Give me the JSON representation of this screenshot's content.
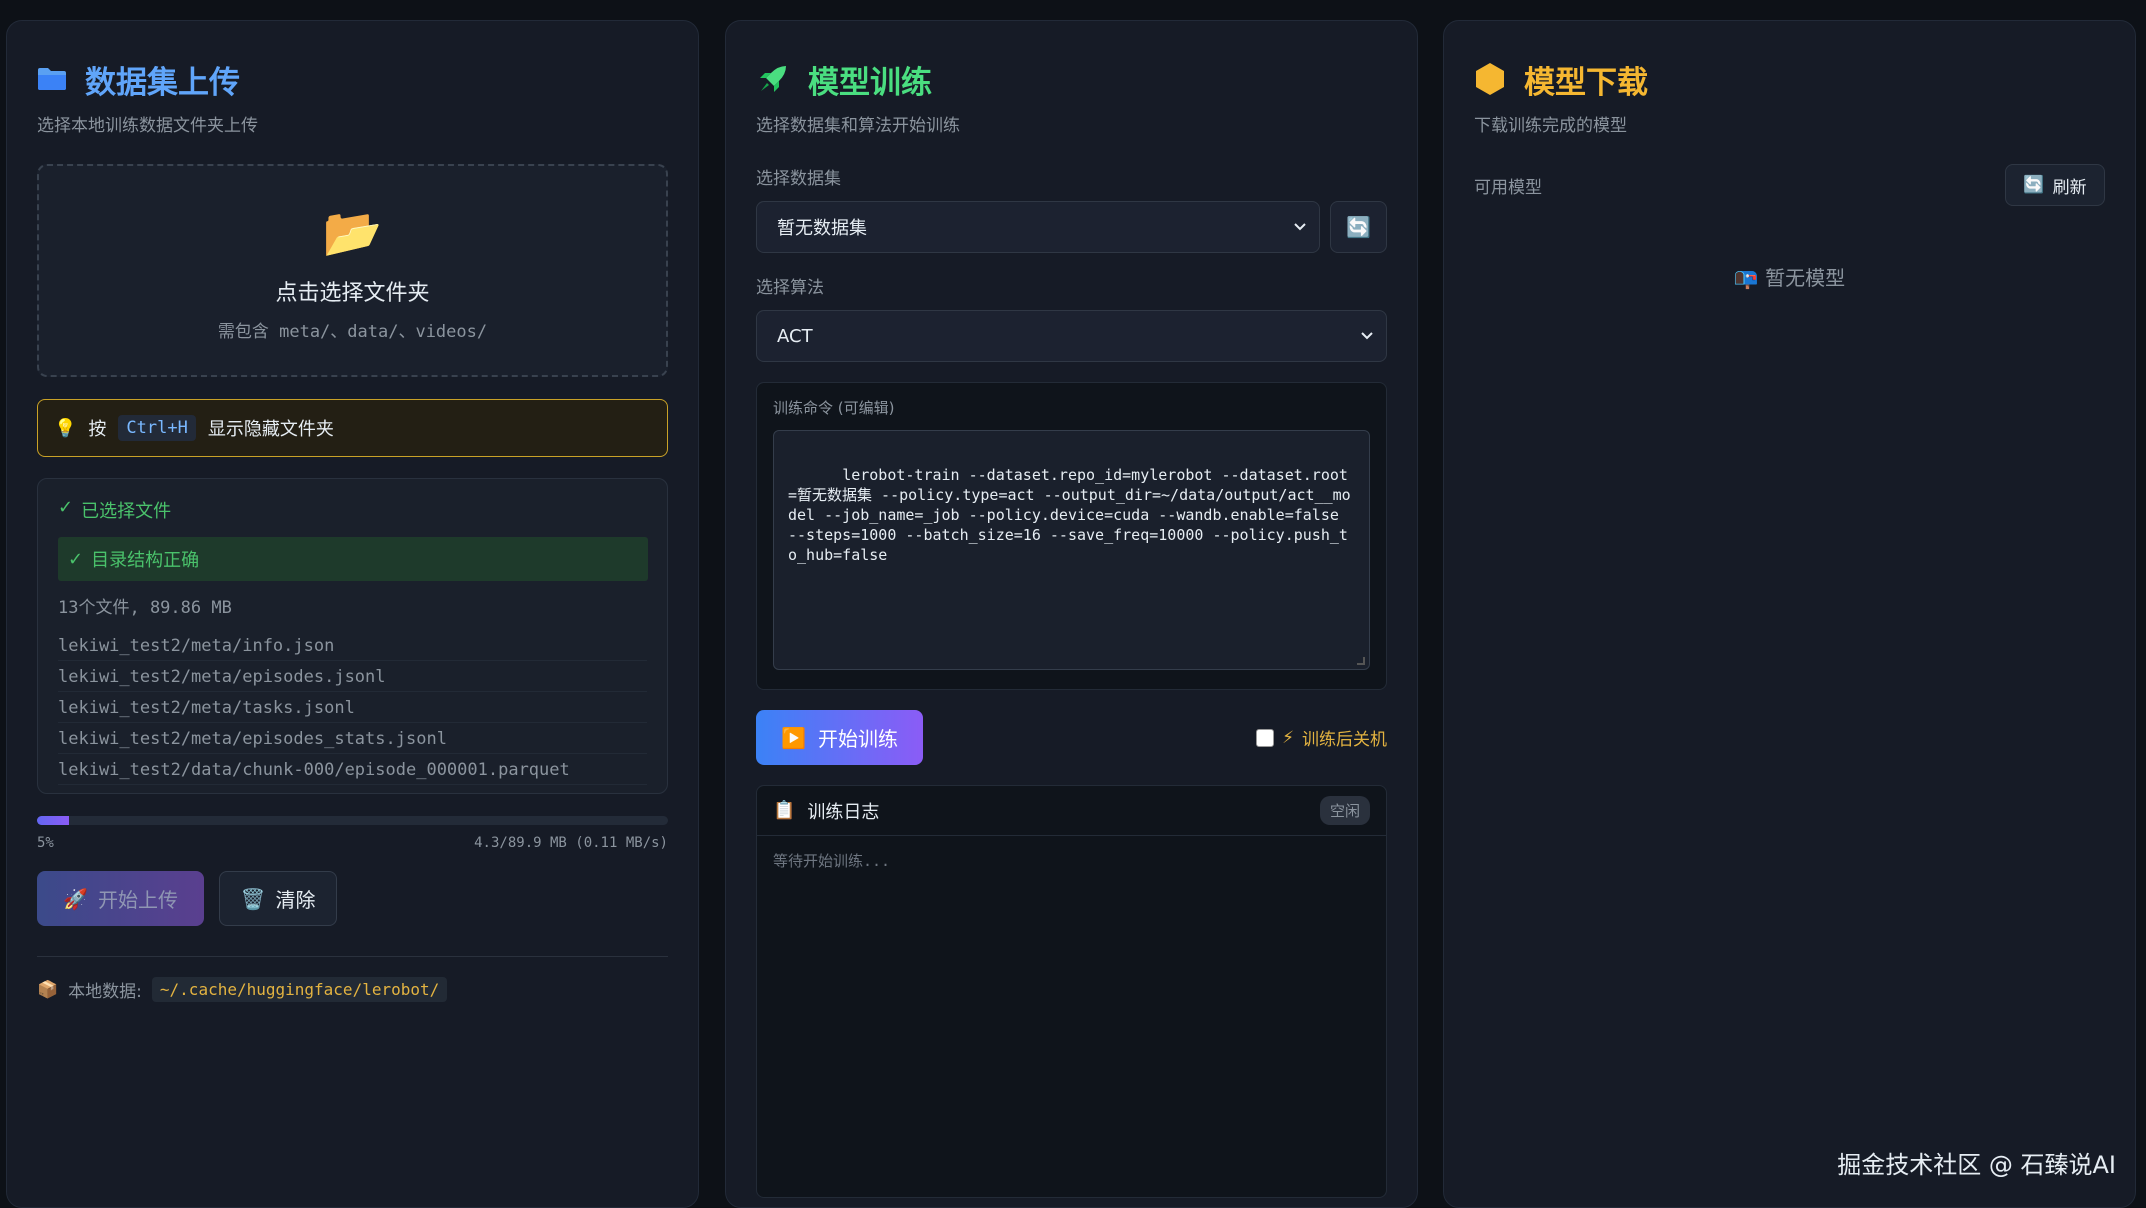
{
  "upload": {
    "title": "数据集上传",
    "title_color": "#60a5fa",
    "subtitle": "选择本地训练数据文件夹上传",
    "icon": "folder-icon",
    "dropzone": {
      "icon": "📂",
      "title": "点击选择文件夹",
      "hint": "需包含 meta/、data/、videos/"
    },
    "tip": {
      "icon": "💡",
      "prefix": "按",
      "key": "Ctrl+H",
      "suffix": "显示隐藏文件夹"
    },
    "selected": {
      "check": "✓",
      "header": "已选择文件",
      "structure_ok": "目录结构正确",
      "stats": "13个文件, 89.86 MB",
      "files": [
        "lekiwi_test2/meta/info.json",
        "lekiwi_test2/meta/episodes.jsonl",
        "lekiwi_test2/meta/tasks.jsonl",
        "lekiwi_test2/meta/episodes_stats.jsonl",
        "lekiwi_test2/data/chunk-000/episode_000001.parquet"
      ]
    },
    "progress": {
      "percent": 5,
      "percent_label": "5%",
      "detail": "4.3/89.9 MB (0.11 MB/s)"
    },
    "buttons": {
      "upload_icon": "🚀",
      "upload": "开始上传",
      "clear_icon": "🗑️",
      "clear": "清除"
    },
    "local": {
      "icon": "📦",
      "label": "本地数据:",
      "path": "~/.cache/huggingface/lerobot/"
    }
  },
  "train": {
    "title": "模型训练",
    "title_color": "#4ade80",
    "subtitle": "选择数据集和算法开始训练",
    "dataset_label": "选择数据集",
    "dataset_value": "暂无数据集",
    "refresh_icon": "🔄",
    "algo_label": "选择算法",
    "algo_value": "ACT",
    "command_label": "训练命令 (可编辑)",
    "command": "lerobot-train --dataset.repo_id=mylerobot --dataset.root=暂无数据集 --policy.type=act --output_dir=~/data/output/act__model --job_name=_job --policy.device=cuda --wandb.enable=false --steps=1000 --batch_size=16 --save_freq=10000 --policy.push_to_hub=false",
    "start_icon": "▶️",
    "start": "开始训练",
    "shutdown_icon": "⚡",
    "shutdown": "训练后关机",
    "log": {
      "icon": "📋",
      "title": "训练日志",
      "status": "空闲",
      "placeholder": "等待开始训练..."
    }
  },
  "download": {
    "title": "模型下载",
    "title_color": "#f5b731",
    "subtitle": "下载训练完成的模型",
    "available_label": "可用模型",
    "refresh_icon": "🔄",
    "refresh": "刷新",
    "empty_icon": "📭",
    "empty": "暂无模型"
  },
  "watermark": "掘金技术社区 @ 石臻说AI"
}
